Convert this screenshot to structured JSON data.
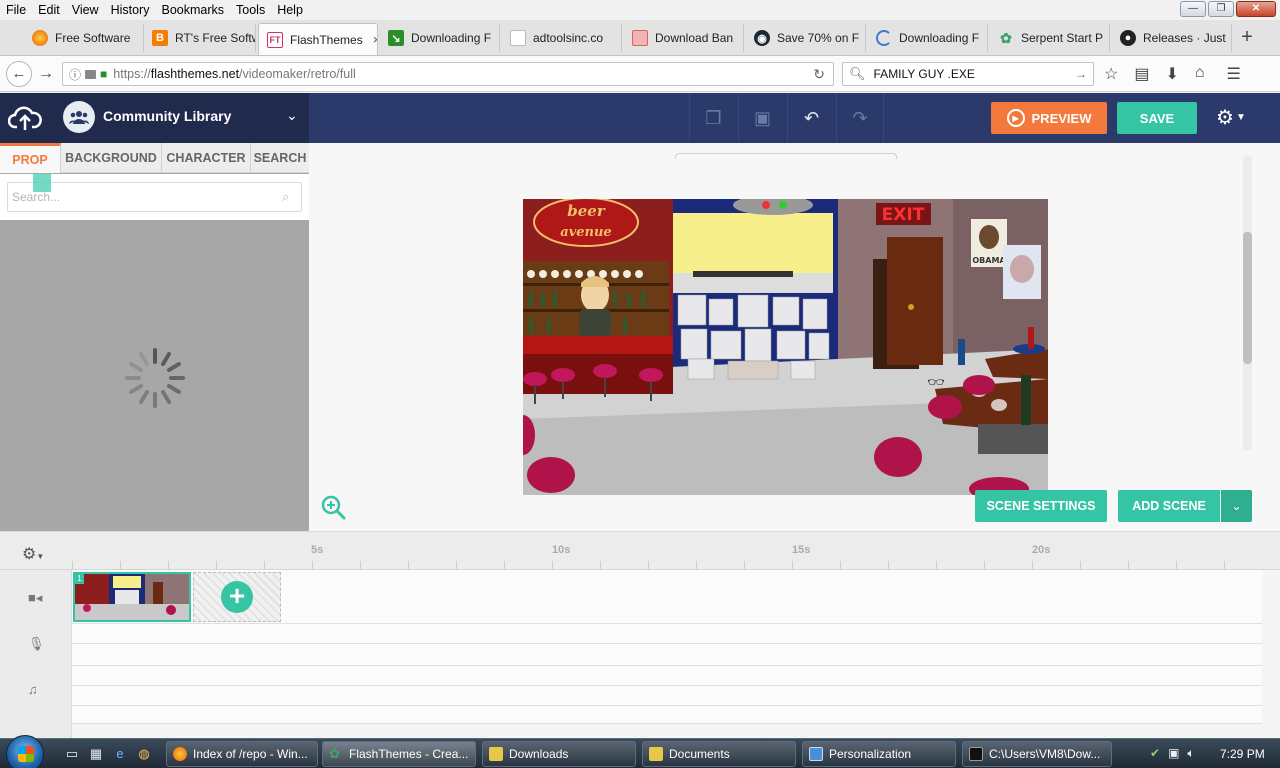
{
  "menu": [
    "File",
    "Edit",
    "View",
    "History",
    "Bookmarks",
    "Tools",
    "Help"
  ],
  "window_buttons": {
    "minimize": "—",
    "restore": "❐",
    "close": "✕"
  },
  "tabs": [
    {
      "label": "Free Software",
      "icon": "firefox-icon",
      "color": "#e66000"
    },
    {
      "label": "RT's Free Softw",
      "icon": "blogger-icon",
      "color": "#f57d00"
    },
    {
      "label": "FlashThemes",
      "icon": "flashthemes-icon",
      "color": "#cc3366"
    },
    {
      "label": "Downloading F",
      "icon": "download-icon",
      "color": "#2a8f2a"
    },
    {
      "label": "adtoolsinc.co",
      "icon": "blank-page-icon",
      "color": "#ffffff"
    },
    {
      "label": "Download Ban",
      "icon": "page-icon",
      "color": "#e06060"
    },
    {
      "label": "Save 70% on F",
      "icon": "steam-icon",
      "color": "#1b2838"
    },
    {
      "label": "Downloading F",
      "icon": "loading-icon",
      "color": "#3a7bd5"
    },
    {
      "label": "Serpent Start P",
      "icon": "serpent-icon",
      "color": "#3aa66a"
    },
    {
      "label": "Releases · Just",
      "icon": "github-icon",
      "color": "#222222"
    }
  ],
  "tab_close": "×",
  "new_tab": "+",
  "address": {
    "prefix": "https://",
    "domain": "flashthemes.net",
    "path": "/videomaker/retro/full"
  },
  "search": {
    "value": "FAMILY GUY .EXE"
  },
  "app": {
    "library_title": "Community Library",
    "preview_label": "PREVIEW",
    "save_label": "SAVE",
    "library_tabs": [
      "PROP",
      "BACKGROUND",
      "CHARACTER",
      "SEARCH"
    ],
    "library_search_placeholder": "Search...",
    "scene_settings_label": "SCENE SETTINGS",
    "add_scene_label": "ADD SCENE",
    "accent_color": "#35c4a4",
    "preview_color": "#f37a3c",
    "header_color": "#2b3a6a"
  },
  "scene": {
    "bar_sign": [
      "beer",
      "avenue"
    ],
    "exit_sign": "EXIT",
    "poster_text": "OBAMA"
  },
  "timeline": {
    "ticks": [
      "5s",
      "10s",
      "15s",
      "20s"
    ],
    "scene_number": "1",
    "add_symbol": "+"
  },
  "taskbar": {
    "tasks": [
      {
        "label": "Index of /repo - Win...",
        "icon": "firefox-icon"
      },
      {
        "label": "FlashThemes - Crea...",
        "icon": "serpent-icon"
      },
      {
        "label": "Downloads",
        "icon": "folder-icon"
      },
      {
        "label": "Documents",
        "icon": "folder-icon"
      },
      {
        "label": "Personalization",
        "icon": "monitor-icon"
      },
      {
        "label": "C:\\Users\\VM8\\Dow...",
        "icon": "cmd-icon"
      }
    ],
    "clock": "7:29 PM"
  }
}
